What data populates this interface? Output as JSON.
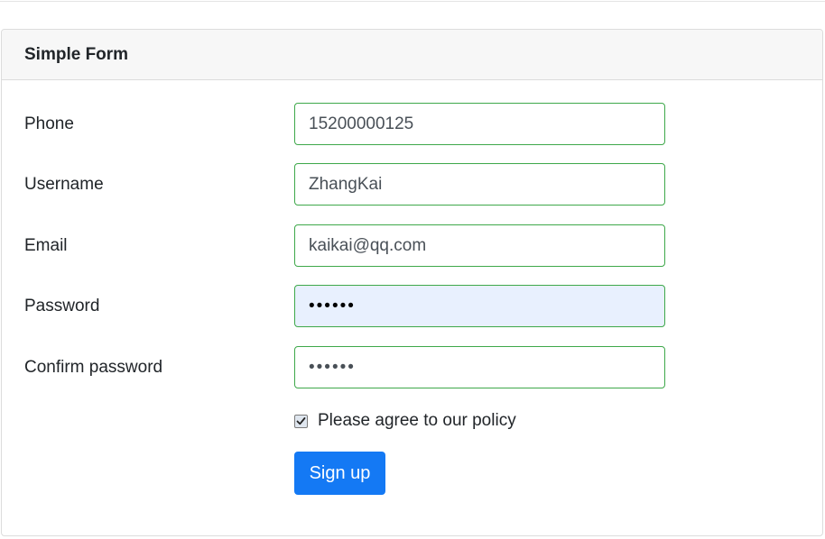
{
  "form": {
    "title": "Simple Form",
    "fields": [
      {
        "label": "Phone",
        "value": "15200000125",
        "type": "text"
      },
      {
        "label": "Username",
        "value": "ZhangKai",
        "type": "text"
      },
      {
        "label": "Email",
        "value": "kaikai@qq.com",
        "type": "email"
      },
      {
        "label": "Password",
        "value": "••••••",
        "type": "password",
        "autofilled": true
      },
      {
        "label": "Confirm password",
        "value": "••••••",
        "type": "password"
      }
    ],
    "policy": {
      "label": "Please agree to our policy",
      "checked": true
    },
    "submit_label": "Sign up"
  },
  "colors": {
    "input_border_valid": "#3ea84a",
    "autofill_bg": "#e8f0fe",
    "primary": "#1479f4",
    "header_bg": "#f7f7f7"
  }
}
